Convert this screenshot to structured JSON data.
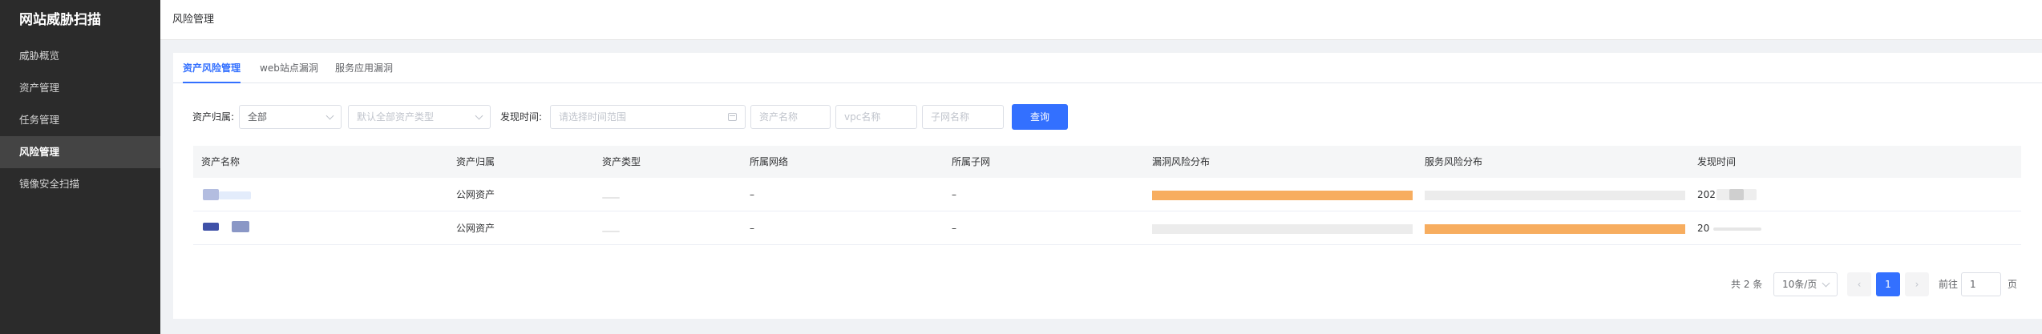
{
  "sidebar": {
    "brand": "网站威胁扫描",
    "items": [
      {
        "label": "威胁概览"
      },
      {
        "label": "资产管理"
      },
      {
        "label": "任务管理"
      },
      {
        "label": "风险管理"
      },
      {
        "label": "镜像安全扫描"
      }
    ]
  },
  "header": {
    "title": "风险管理"
  },
  "tabs": [
    {
      "label": "资产风险管理"
    },
    {
      "label": "web站点漏洞"
    },
    {
      "label": "服务应用漏洞"
    }
  ],
  "filters": {
    "owner_label": "资产归属:",
    "owner_value": "全部",
    "type_placeholder": "默认全部资产类型",
    "time_label": "发现时间:",
    "time_placeholder": "请选择时间范围",
    "name_placeholder": "资产名称",
    "vpc_placeholder": "vpc名称",
    "subnet_placeholder": "子网名称",
    "query_label": "查询"
  },
  "table": {
    "headers": [
      "资产名称",
      "资产归属",
      "资产类型",
      "所属网络",
      "所属子网",
      "漏洞风险分布",
      "服务风险分布",
      "发现时间"
    ],
    "rows": [
      {
        "owner": "公网资产",
        "network": "–",
        "subnet": "–",
        "vuln_risk_fill": 1.0,
        "service_risk_fill": 0.0,
        "time": "202"
      },
      {
        "owner": "公网资产",
        "network": "–",
        "subnet": "–",
        "vuln_risk_fill": 0.0,
        "service_risk_fill": 1.0,
        "time": "20"
      }
    ]
  },
  "pagination": {
    "total": "共 2 条",
    "page_size": "10条/页",
    "prev": "‹",
    "current_page": "1",
    "next": "›",
    "goto_label": "前往",
    "goto_value": "1",
    "page_suffix": "页"
  },
  "colors": {
    "primary": "#3370ff",
    "risk_bar": "#f7ad5f",
    "empty_bar": "#ececec"
  }
}
